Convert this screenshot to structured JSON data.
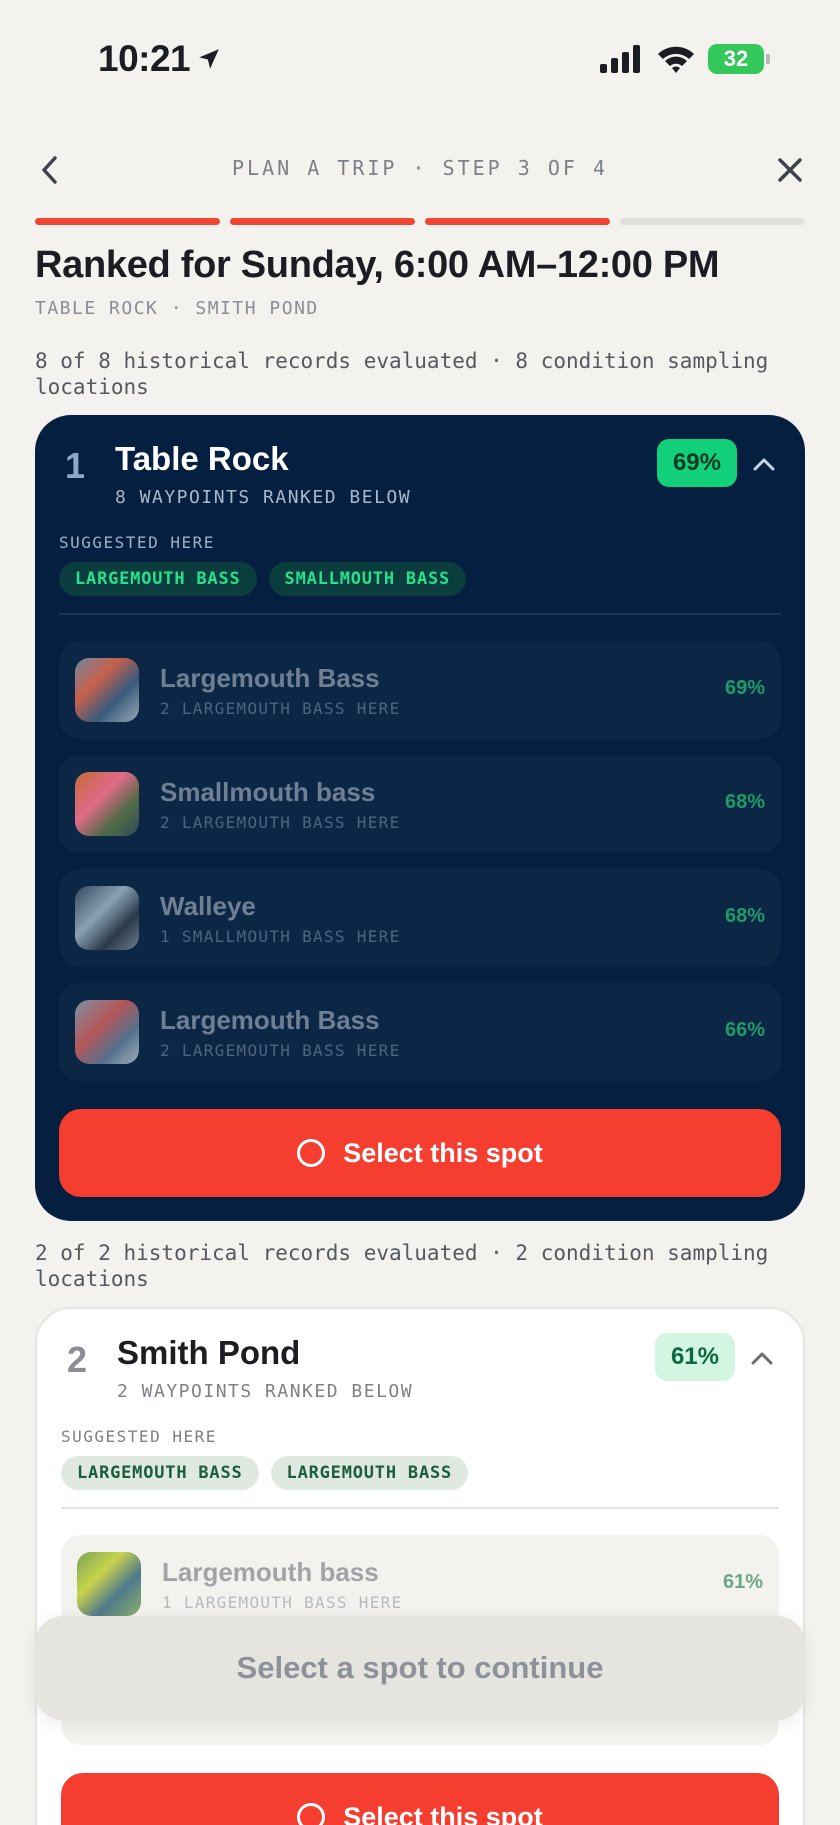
{
  "status_bar": {
    "time": "10:21",
    "battery": "32"
  },
  "nav": {
    "title": "PLAN A TRIP · STEP 3 OF 4",
    "steps_total": 4,
    "steps_done": 3
  },
  "header": {
    "title": "Ranked for Sunday, 6:00 AM–12:00 PM",
    "subtitle": "TABLE ROCK · SMITH POND"
  },
  "spots": [
    {
      "records": "8 of 8 historical records evaluated · 8 condition sampling locations",
      "rank": "1",
      "name": "Table Rock",
      "waypoints": "8 WAYPOINTS RANKED BELOW",
      "score": "69%",
      "suggested_label": "SUGGESTED HERE",
      "chips": [
        "LARGEMOUTH BASS",
        "SMALLMOUTH BASS"
      ],
      "rows": [
        {
          "species": "Largemouth Bass",
          "detail": "2 LARGEMOUTH BASS HERE",
          "pct": "69%"
        },
        {
          "species": "Smallmouth bass",
          "detail": "2 LARGEMOUTH BASS HERE",
          "pct": "68%"
        },
        {
          "species": "Walleye",
          "detail": "1 SMALLMOUTH BASS HERE",
          "pct": "68%"
        },
        {
          "species": "Largemouth Bass",
          "detail": "2 LARGEMOUTH BASS HERE",
          "pct": "66%"
        }
      ],
      "select_label": "Select this spot"
    },
    {
      "records": "2 of 2 historical records evaluated · 2 condition sampling locations",
      "rank": "2",
      "name": "Smith Pond",
      "waypoints": "2 WAYPOINTS RANKED BELOW",
      "score": "61%",
      "suggested_label": "SUGGESTED HERE",
      "chips": [
        "LARGEMOUTH BASS",
        "LARGEMOUTH BASS"
      ],
      "rows": [
        {
          "species": "Largemouth bass",
          "detail": "1 LARGEMOUTH BASS HERE",
          "pct": "61%"
        }
      ],
      "select_label": "Select this spot"
    }
  ],
  "footer": {
    "continue_label": "Select a spot to continue"
  },
  "colors": {
    "accent": "#f53e2f",
    "dark_card": "#051f40",
    "score_green": "#12d07a"
  }
}
